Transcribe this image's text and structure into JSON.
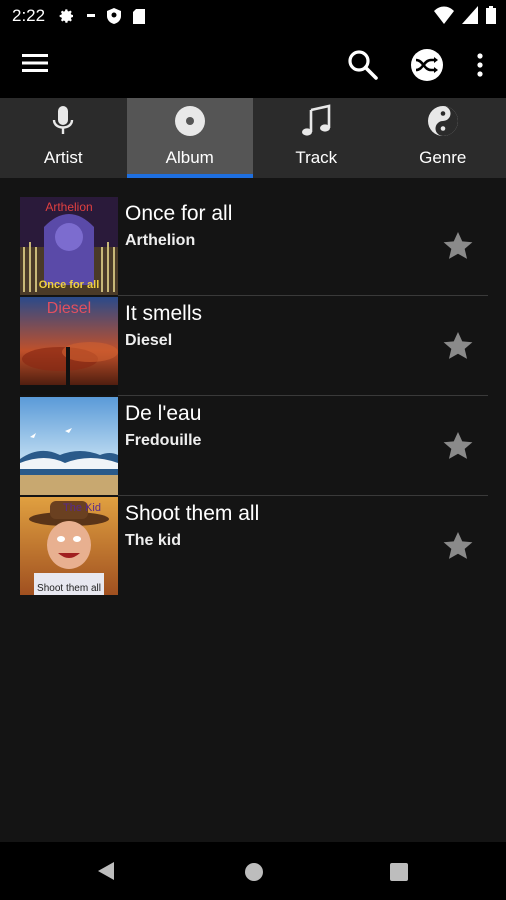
{
  "status_bar": {
    "time": "2:22"
  },
  "tabs": [
    {
      "label": "Artist",
      "icon": "microphone-icon",
      "active": false
    },
    {
      "label": "Album",
      "icon": "disc-icon",
      "active": true
    },
    {
      "label": "Track",
      "icon": "music-note-icon",
      "active": false
    },
    {
      "label": "Genre",
      "icon": "yin-yang-icon",
      "active": false
    }
  ],
  "albums": [
    {
      "title": "Once for all",
      "artist": "Arthelion",
      "art_top_text": "Arthelion",
      "art_bottom_text": "Once for all"
    },
    {
      "title": "It smells",
      "artist": "Diesel",
      "art_top_text": "Diesel"
    },
    {
      "title": "De l'eau",
      "artist": "Fredouille"
    },
    {
      "title": "Shoot them all",
      "artist": "The kid",
      "art_top_text": "The Kid",
      "art_bottom_text": "Shoot them all"
    }
  ],
  "colors": {
    "accent": "#1e6fe0",
    "background": "#141414",
    "tab_bar": "#2b2b2b",
    "tab_active": "#555555",
    "star": "#8a8a8a"
  }
}
